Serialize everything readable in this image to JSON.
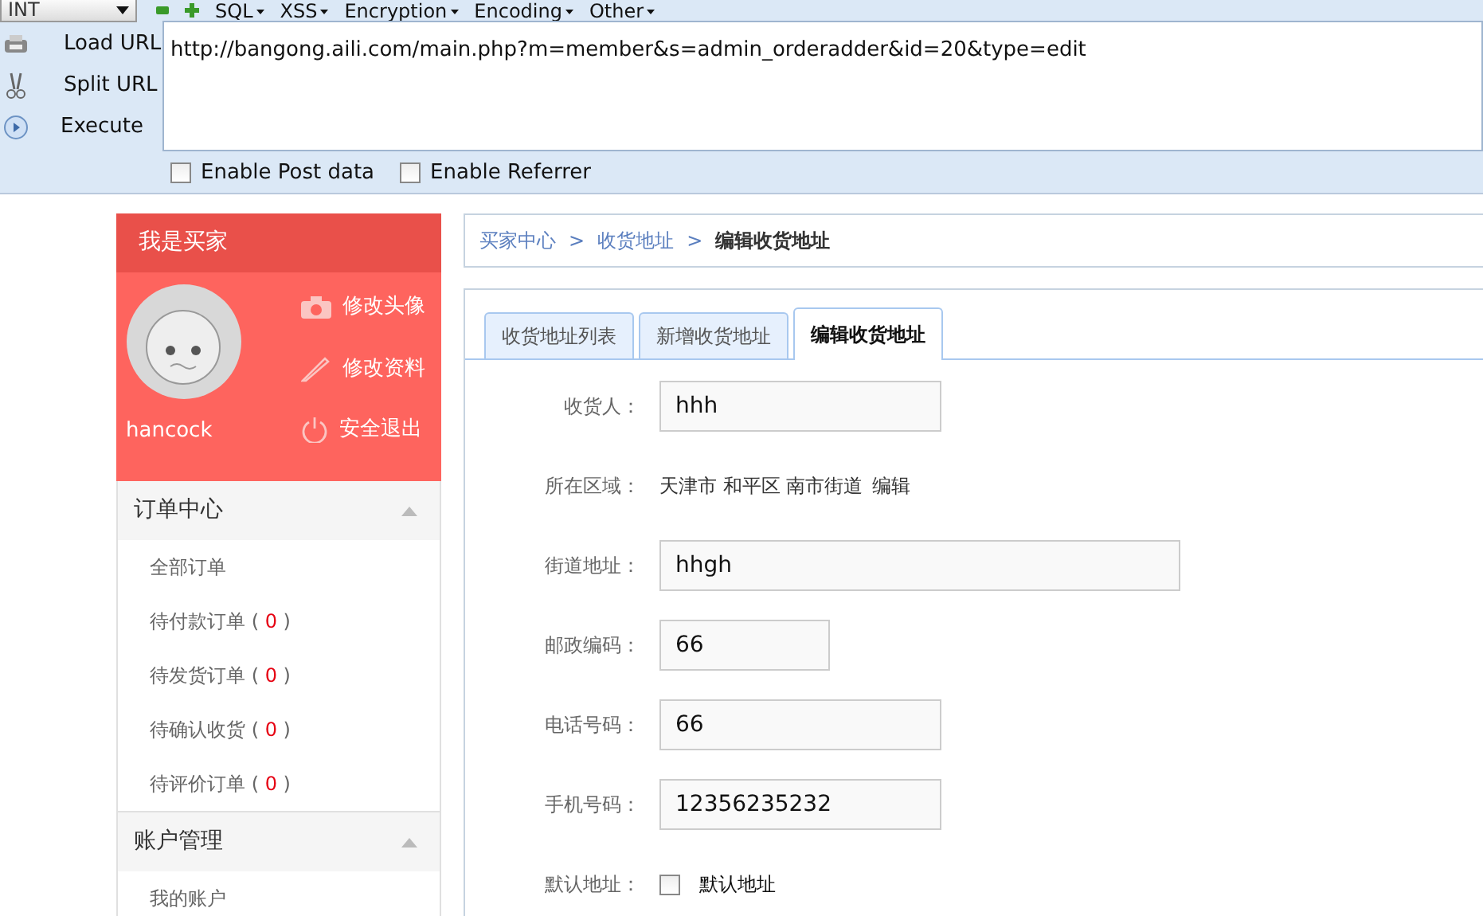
{
  "toolbar": {
    "select_value": "INT",
    "menus": [
      "SQL",
      "XSS",
      "Encryption",
      "Encoding",
      "Other"
    ],
    "actions": [
      {
        "kind": "load",
        "label": "Load URL"
      },
      {
        "kind": "split",
        "label": "Split URL"
      },
      {
        "kind": "execute",
        "label": "Execute"
      }
    ],
    "url": "http://bangong.aili.com/main.php?m=member&s=admin_orderadder&id=20&type=edit",
    "options": [
      {
        "label": "Enable Post data",
        "checked": false
      },
      {
        "label": "Enable Referrer",
        "checked": false
      }
    ]
  },
  "sidebar": {
    "title": "我是买家",
    "username": "hancock",
    "profile_links": [
      {
        "kind": "camera",
        "label": "修改头像"
      },
      {
        "kind": "pencil",
        "label": "修改资料"
      },
      {
        "kind": "power",
        "label": "安全退出"
      }
    ],
    "sections": [
      {
        "title": "订单中心",
        "expanded": true,
        "items": [
          {
            "label": "全部订单"
          },
          {
            "label": "待付款订单",
            "count_prefix": "(",
            "count": "0",
            "count_suffix": ")"
          },
          {
            "label": "待发货订单",
            "count_prefix": "(",
            "count": "0",
            "count_suffix": ")"
          },
          {
            "label": "待确认收货",
            "count_prefix": "(",
            "count": "0",
            "count_suffix": ")"
          },
          {
            "label": "待评价订单",
            "count_prefix": "(",
            "count": "0",
            "count_suffix": ")"
          }
        ]
      },
      {
        "title": "账户管理",
        "expanded": true,
        "items": [
          {
            "label": "我的账户"
          }
        ]
      }
    ]
  },
  "breadcrumb": [
    {
      "kind": "link",
      "label": "买家中心"
    },
    {
      "kind": "separator",
      "label": ">"
    },
    {
      "kind": "link",
      "label": "收货地址"
    },
    {
      "kind": "separator",
      "label": ">"
    },
    {
      "kind": "current",
      "label": "编辑收货地址"
    }
  ],
  "tabs": [
    {
      "label": "收货地址列表",
      "selected": false
    },
    {
      "label": "新增收货地址",
      "selected": false
    },
    {
      "label": "编辑收货地址",
      "selected": true
    }
  ],
  "form": [
    {
      "kind": "text",
      "label": "收货人：",
      "value": "hhh"
    },
    {
      "kind": "region",
      "label": "所在区域：",
      "value": "天津市 和平区 南市街道",
      "link": "编辑"
    },
    {
      "kind": "wide",
      "label": "街道地址：",
      "value": "hhgh"
    },
    {
      "kind": "short",
      "label": "邮政编码：",
      "value": "66"
    },
    {
      "kind": "text",
      "label": "电话号码：",
      "value": "66"
    },
    {
      "kind": "text",
      "label": "手机号码：",
      "value": "12356235232"
    },
    {
      "kind": "checkbox",
      "label": "默认地址：",
      "option": "默认地址",
      "checked": false
    }
  ]
}
